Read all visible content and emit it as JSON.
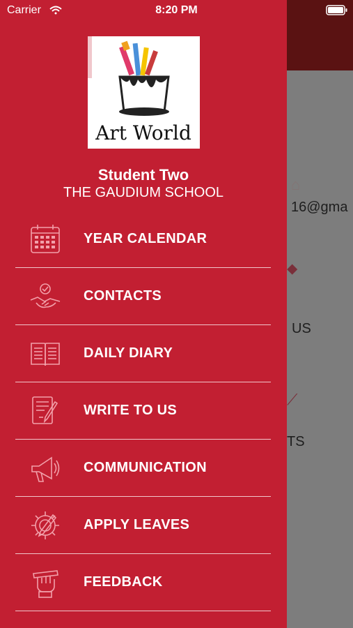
{
  "status_bar": {
    "carrier": "Carrier",
    "time": "8:20 PM"
  },
  "logo": {
    "text": "Art World"
  },
  "profile": {
    "student_name": "Student Two",
    "school_name": "THE GAUDIUM SCHOOL"
  },
  "menu": [
    {
      "label": "YEAR CALENDAR",
      "icon": "calendar-icon"
    },
    {
      "label": "CONTACTS",
      "icon": "handshake-icon"
    },
    {
      "label": "DAILY DIARY",
      "icon": "open-book-icon"
    },
    {
      "label": "WRITE TO US",
      "icon": "write-document-icon"
    },
    {
      "label": "COMMUNICATION",
      "icon": "megaphone-icon"
    },
    {
      "label": "APPLY LEAVES",
      "icon": "gear-pencil-icon"
    },
    {
      "label": "FEEDBACK",
      "icon": "hand-pencil-icon"
    }
  ],
  "background": {
    "email_fragment": "16@gma",
    "item_fragment_1": "US",
    "item_fragment_2": "TS"
  },
  "colors": {
    "drawer": "#c21f32",
    "header_behind": "#5a1212",
    "text": "#ffffff"
  }
}
